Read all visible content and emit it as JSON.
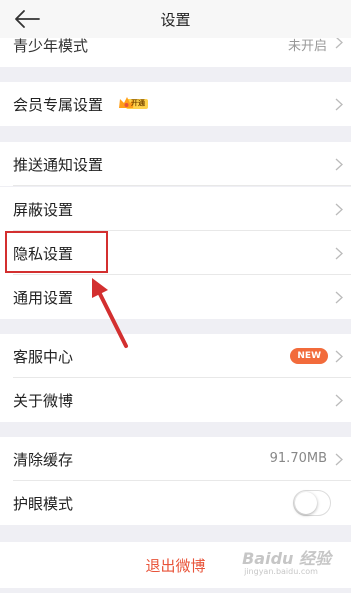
{
  "header": {
    "title": "设置"
  },
  "rows": {
    "youth_mode": {
      "label": "青少年模式",
      "value": "未开启"
    },
    "vip_settings": {
      "label": "会员专属设置",
      "badge": "开通"
    },
    "push_notifications": {
      "label": "推送通知设置"
    },
    "block_settings": {
      "label": "屏蔽设置"
    },
    "privacy_settings": {
      "label": "隐私设置"
    },
    "general_settings": {
      "label": "通用设置"
    },
    "customer_service": {
      "label": "客服中心",
      "badge": "NEW"
    },
    "about": {
      "label": "关于微博"
    },
    "clear_cache": {
      "label": "清除缓存",
      "value": "91.70MB"
    },
    "eye_protection": {
      "label": "护眼模式",
      "enabled": false
    }
  },
  "logout": {
    "label": "退出微博"
  },
  "watermark": {
    "main": "Baidu 经验",
    "sub": "jingyan.baidu.com"
  },
  "colors": {
    "accent": "#e8543a",
    "new_badge": "#f26b3b",
    "annotation": "#d32f2f",
    "background": "#efeff4"
  }
}
